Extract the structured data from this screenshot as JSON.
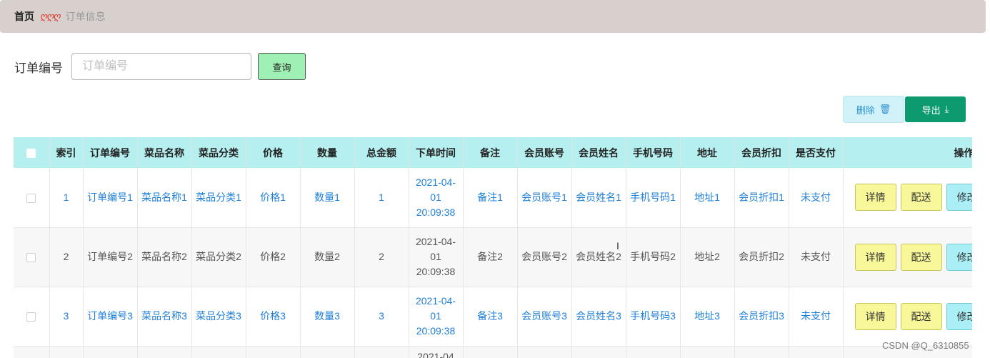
{
  "breadcrumb": {
    "home": "首页",
    "separator": "ღღღ",
    "current": "订单信息"
  },
  "search": {
    "label": "订单编号",
    "placeholder": "订单编号",
    "value": "",
    "button": "查询"
  },
  "toolbar": {
    "delete_label": "删除",
    "delete_icon": "trash-icon",
    "export_label": "导出",
    "export_icon": "download-icon"
  },
  "table": {
    "headers": [
      "索引",
      "订单编号",
      "菜品名称",
      "菜品分类",
      "价格",
      "数量",
      "总金额",
      "下单时间",
      "备注",
      "会员账号",
      "会员姓名",
      "手机号码",
      "地址",
      "会员折扣",
      "是否支付",
      "操作"
    ],
    "rows": [
      {
        "index": "1",
        "order_no": "订单编号1",
        "dish_name": "菜品名称1",
        "dish_category": "菜品分类1",
        "price": "价格1",
        "quantity": "数量1",
        "total": "1",
        "order_time": "2021-04-01 20:09:38",
        "remark": "备注1",
        "member_account": "会员账号1",
        "member_name": "会员姓名1",
        "phone": "手机号码1",
        "address": "地址1",
        "discount": "会员折扣1",
        "paid": "未支付"
      },
      {
        "index": "2",
        "order_no": "订单编号2",
        "dish_name": "菜品名称2",
        "dish_category": "菜品分类2",
        "price": "价格2",
        "quantity": "数量2",
        "total": "2",
        "order_time": "2021-04-01 20:09:38",
        "remark": "备注2",
        "member_account": "会员账号2",
        "member_name": "会员姓名2",
        "phone": "手机号码2",
        "address": "地址2",
        "discount": "会员折扣2",
        "paid": "未支付"
      },
      {
        "index": "3",
        "order_no": "订单编号3",
        "dish_name": "菜品名称3",
        "dish_category": "菜品分类3",
        "price": "价格3",
        "quantity": "数量3",
        "total": "3",
        "order_time": "2021-04-01 20:09:38",
        "remark": "备注3",
        "member_account": "会员账号3",
        "member_name": "会员姓名3",
        "phone": "手机号码3",
        "address": "地址3",
        "discount": "会员折扣3",
        "paid": "未支付"
      }
    ],
    "partial_row": {
      "order_time": "2021-04"
    },
    "actions": {
      "detail": "详情",
      "deliver": "配送",
      "edit": "修改"
    }
  },
  "watermark": "CSDN @Q_6310855",
  "colors": {
    "header_bg": "#b6efef",
    "link_blue": "#1e7fd8",
    "export_green": "#0c9b6e",
    "query_green": "#9ff0b4",
    "action_yellow": "#f8f89a",
    "action_cyan": "#a9eff5"
  }
}
